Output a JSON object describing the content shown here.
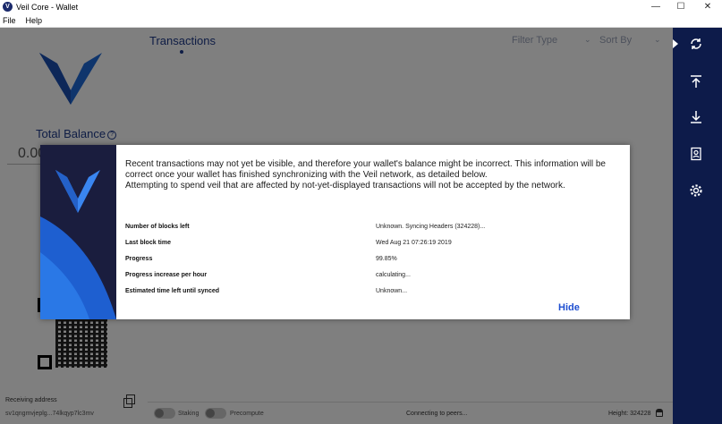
{
  "window": {
    "title": "Veil Core - Wallet",
    "minimize_glyph": "—",
    "maximize_glyph": "☐",
    "close_glyph": "✕"
  },
  "menu": {
    "items": [
      "File",
      "Help"
    ]
  },
  "left": {
    "total_balance_label": "Total Balance",
    "balance_value": "0.00",
    "receiving_address_label": "Receiving address",
    "address_value": "sv1qngmvjeplg...74lkqyp7lc3mv"
  },
  "transactions": {
    "tab_label": "Transactions",
    "filter_label": "Filter Type",
    "sort_label": "Sort By"
  },
  "statusbar": {
    "staking_label": "Staking",
    "precompute_label": "Precompute",
    "status": "Connecting to peers...",
    "height": "Height: 324228"
  },
  "sidebar": {
    "icons": [
      "sync-icon",
      "send-icon",
      "receive-icon",
      "address-book-icon",
      "settings-icon"
    ]
  },
  "modal": {
    "paragraph_1": "Recent transactions may not yet be visible, and therefore your wallet's balance might be incorrect. This information will be correct once your wallet has finished synchronizing with the Veil network, as detailed below.",
    "paragraph_2": "Attempting to spend veil that are affected by not-yet-displayed transactions will not be accepted by the network.",
    "rows": [
      {
        "label": "Number of blocks left",
        "value": "Unknown. Syncing Headers (324228)..."
      },
      {
        "label": "Last block time",
        "value": "Wed Aug 21 07:26:19 2019"
      },
      {
        "label": "Progress",
        "value": "99.85%"
      },
      {
        "label": "Progress increase per hour",
        "value": "calculating..."
      },
      {
        "label": "Estimated time left until synced",
        "value": "Unknown..."
      }
    ],
    "hide_label": "Hide"
  },
  "colors": {
    "sidebar_bg": "#0d1b4a",
    "accent": "#1e3a8a",
    "logo_blue": "#1e6ad8",
    "link_blue": "#1e4fd1"
  }
}
